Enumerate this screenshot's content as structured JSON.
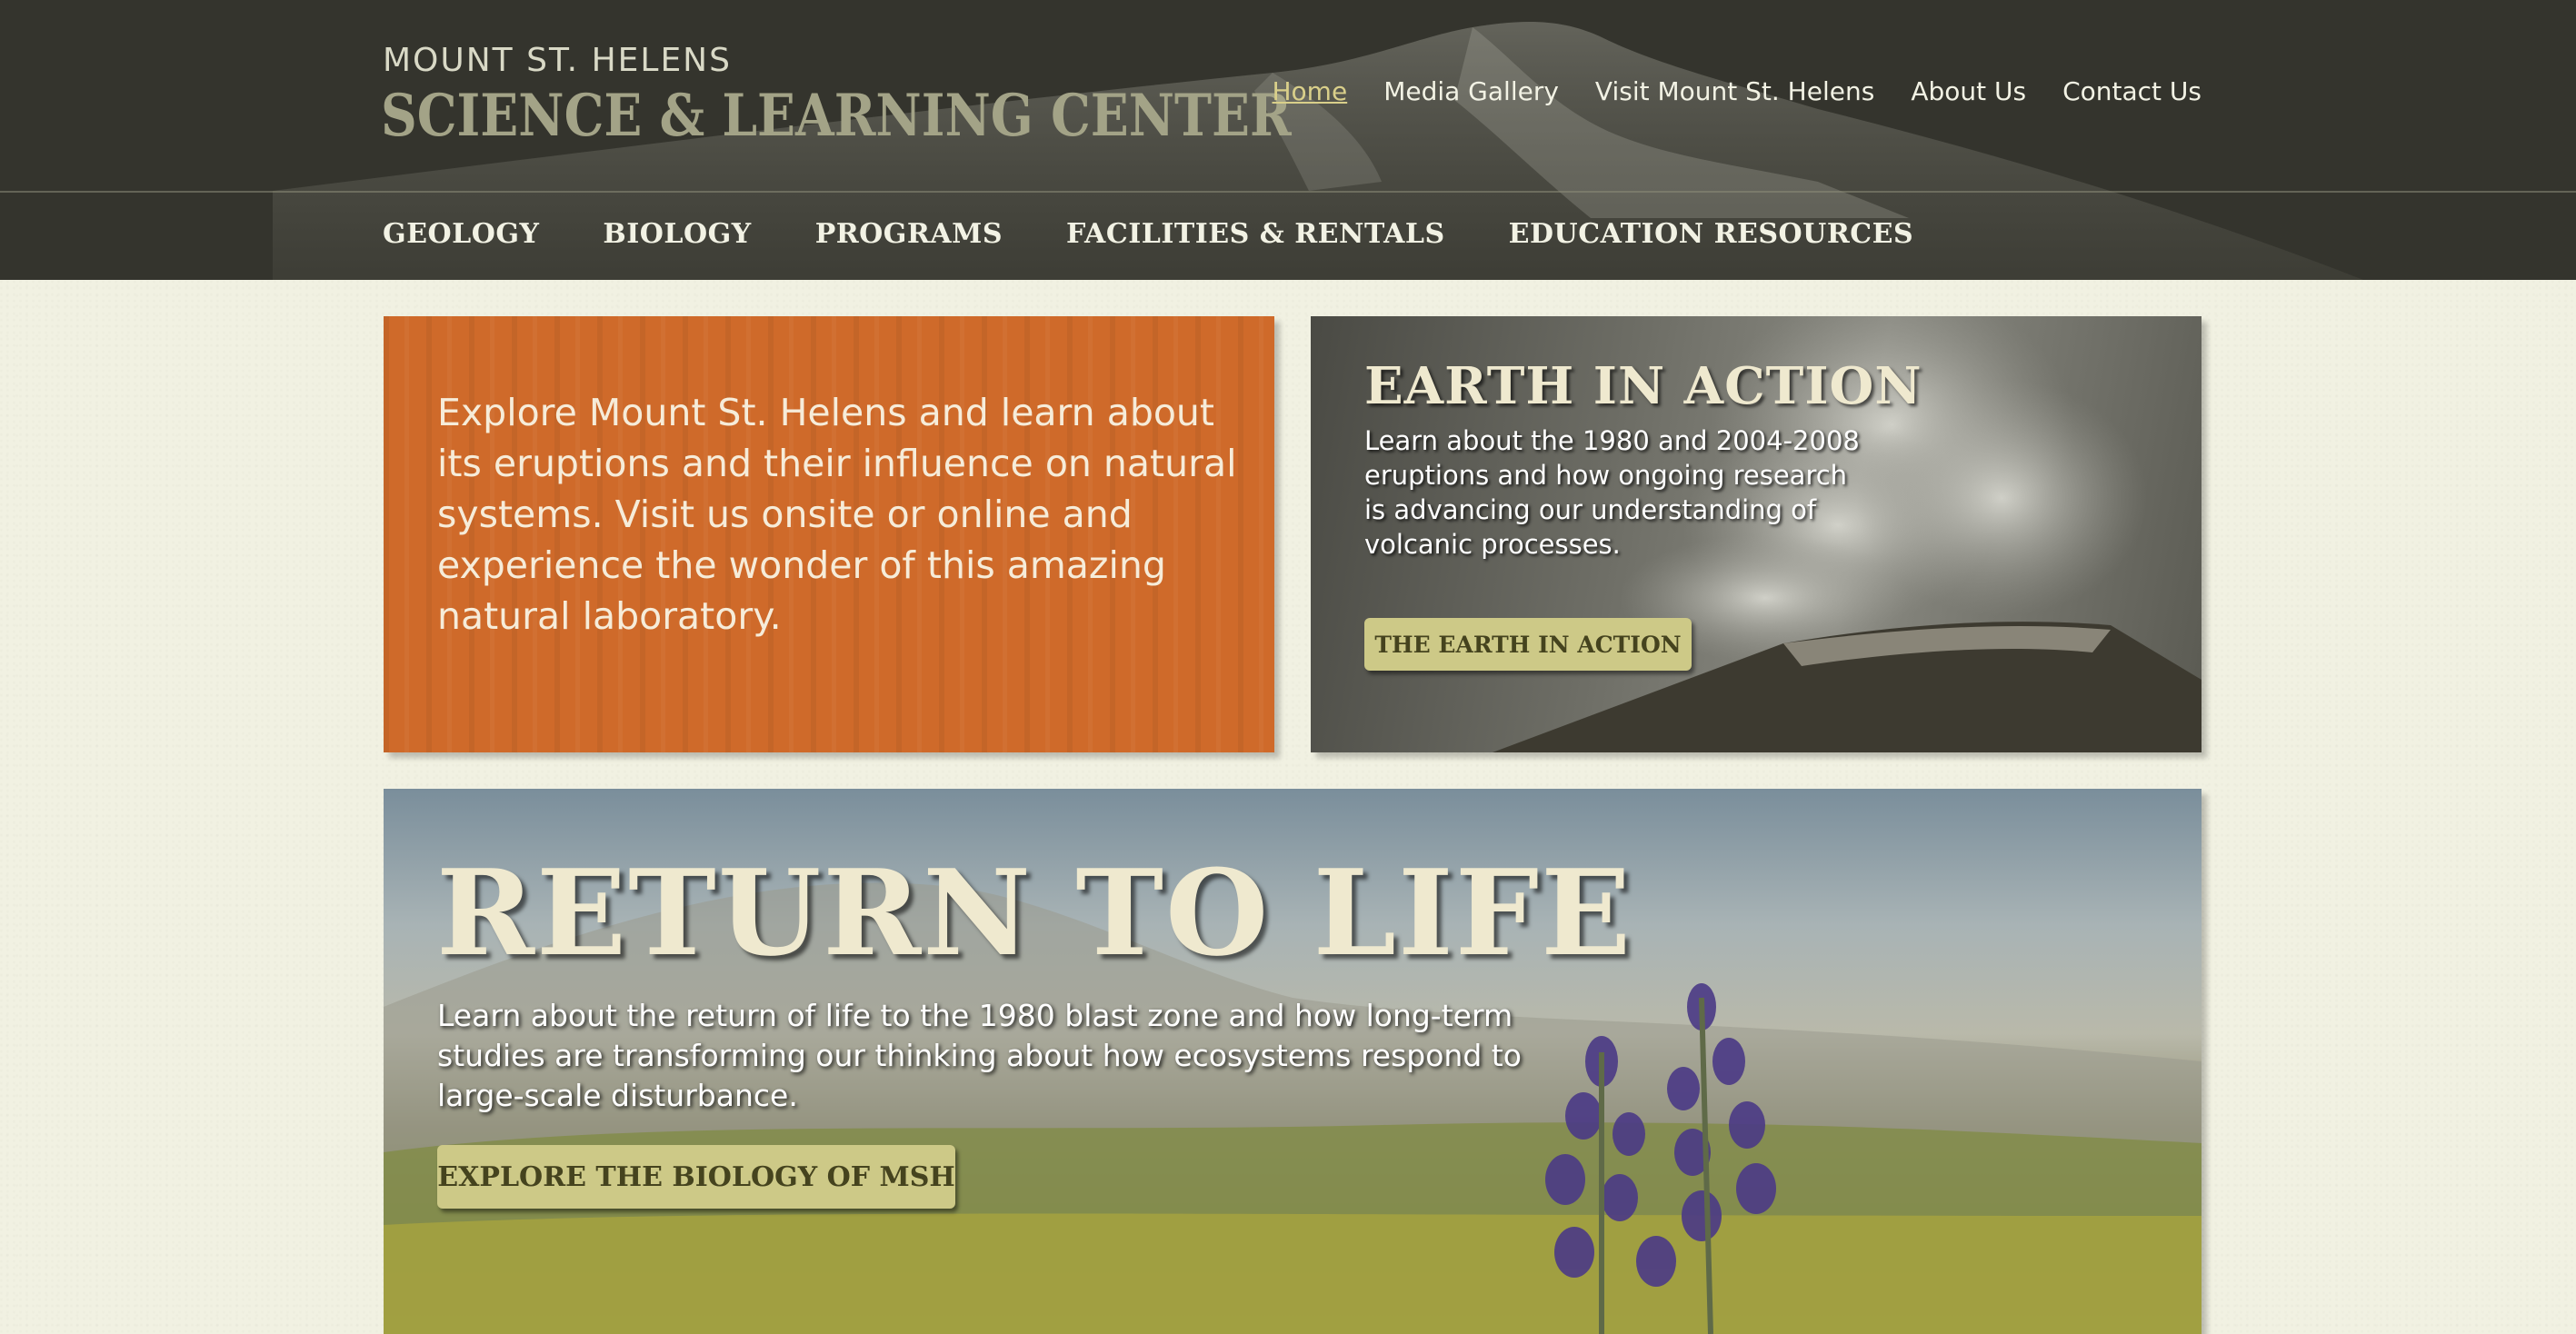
{
  "header": {
    "logo_top": "MOUNT ST. HELENS",
    "logo_main": "SCIENCE & LEARNING CENTER",
    "top_nav": [
      {
        "label": "Home",
        "active": true
      },
      {
        "label": "Media Gallery"
      },
      {
        "label": "Visit Mount St. Helens"
      },
      {
        "label": "About Us"
      },
      {
        "label": "Contact Us"
      }
    ],
    "main_nav": [
      {
        "label": "GEOLOGY"
      },
      {
        "label": "BIOLOGY"
      },
      {
        "label": "PROGRAMS"
      },
      {
        "label": "FACILITIES & RENTALS"
      },
      {
        "label": "EDUCATION RESOURCES"
      }
    ]
  },
  "intro_panel": {
    "text": "Explore Mount St. Helens and learn about its eruptions and their influence on natural systems.  Visit us onsite or online and experience the wonder of this amazing natural laboratory."
  },
  "earth_panel": {
    "title": "EARTH IN ACTION",
    "text": "Learn about the 1980 and 2004-2008 eruptions and how ongoing research is advancing our understanding of volcanic processes.",
    "button_label": "THE EARTH IN ACTION"
  },
  "life_panel": {
    "title": "RETURN TO LIFE",
    "text": "Learn about the return of life to the 1980 blast zone and how long-term studies are transforming our thinking about how ecosystems respond to large-scale disturbance.",
    "button_label": "EXPLORE THE BIOLOGY OF MSH"
  },
  "colors": {
    "header_bg": "#34342d",
    "page_bg": "#f1f1e2",
    "orange_panel": "#cf6a2a",
    "button_bg": "#cdc987",
    "button_text": "#45431e",
    "active_link": "#d9cf8a"
  }
}
